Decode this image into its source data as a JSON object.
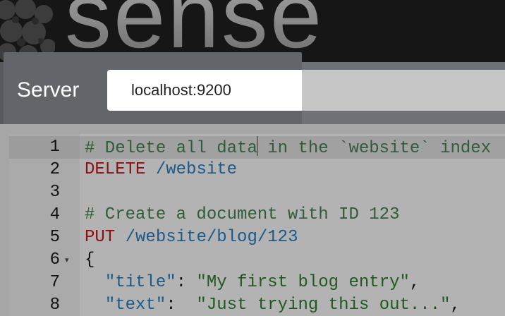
{
  "header": {
    "brand": "sense",
    "logo_icon": "cluster-logo-icon"
  },
  "server": {
    "label": "Server",
    "value": "localhost:9200"
  },
  "editor": {
    "cursor_line": 1,
    "lines": [
      {
        "number": "1",
        "tokens": [
          {
            "type": "comment",
            "text": "# Delete all data"
          },
          {
            "type": "cursor",
            "text": ""
          },
          {
            "type": "comment",
            "text": " in the `website` index"
          }
        ]
      },
      {
        "number": "2",
        "tokens": [
          {
            "type": "method",
            "text": "DELETE"
          },
          {
            "type": "punct",
            "text": " "
          },
          {
            "type": "path",
            "text": "/website"
          }
        ]
      },
      {
        "number": "3",
        "tokens": []
      },
      {
        "number": "4",
        "tokens": [
          {
            "type": "comment",
            "text": "# Create a document with ID 123"
          }
        ]
      },
      {
        "number": "5",
        "tokens": [
          {
            "type": "method",
            "text": "PUT"
          },
          {
            "type": "punct",
            "text": " "
          },
          {
            "type": "path",
            "text": "/website/blog/123"
          }
        ]
      },
      {
        "number": "6",
        "fold": true,
        "tokens": [
          {
            "type": "punct",
            "text": "{"
          }
        ]
      },
      {
        "number": "7",
        "tokens": [
          {
            "type": "punct",
            "text": "  "
          },
          {
            "type": "key",
            "text": "\"title\""
          },
          {
            "type": "punct",
            "text": ": "
          },
          {
            "type": "string",
            "text": "\"My first blog entry\""
          },
          {
            "type": "punct",
            "text": ","
          }
        ]
      },
      {
        "number": "8",
        "tokens": [
          {
            "type": "punct",
            "text": "  "
          },
          {
            "type": "key",
            "text": "\"text\""
          },
          {
            "type": "punct",
            "text": ":  "
          },
          {
            "type": "string",
            "text": "\"Just trying this out...\""
          },
          {
            "type": "punct",
            "text": ","
          }
        ]
      }
    ]
  }
}
